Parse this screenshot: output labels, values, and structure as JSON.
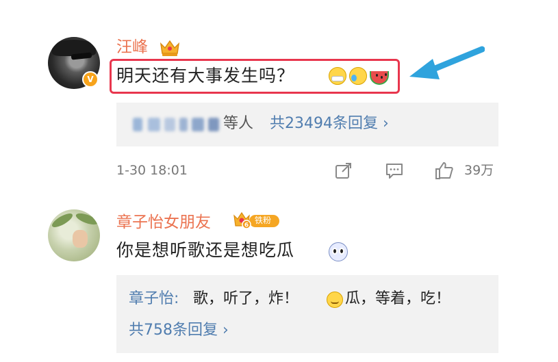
{
  "comments": [
    {
      "author": "汪峰",
      "verified_badge": "V",
      "text": "明天还有大事发生吗？",
      "emojis": [
        "mask-face-emoji",
        "laugh-cry-emoji",
        "watermelon-emoji"
      ],
      "reply_preview_suffix": "等人",
      "reply_link": "共23494条回复 ›",
      "time": "1-30 18:01",
      "like_count": "39万"
    },
    {
      "author": "章子怡女朋友",
      "fan_badge": "铁粉",
      "text": "你是想听歌还是想吃瓜",
      "emojis": [
        "scared-face-emoji"
      ],
      "sub_reply": {
        "author": "章子怡:",
        "text_before_emoji": "歌，听了，炸！",
        "text_after_emoji": "瓜，等着，吃！"
      },
      "reply_link": "共758条回复 ›"
    }
  ],
  "colors": {
    "name": "#eb7350",
    "link": "#507daf",
    "highlight_box": "#e8364d",
    "arrow": "#2fa3dd"
  }
}
